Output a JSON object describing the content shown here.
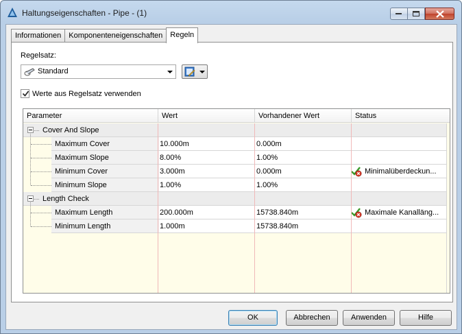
{
  "window": {
    "title": "Haltungseigenschaften - Pipe - (1)"
  },
  "tabs": [
    {
      "label": "Informationen"
    },
    {
      "label": "Komponenteneigenschaften"
    },
    {
      "label": "Regeln"
    }
  ],
  "ruleset": {
    "label": "Regelsatz:",
    "selected": "Standard",
    "use_ruleset_values_label": "Werte aus Regelsatz verwenden",
    "use_ruleset_values_checked": true
  },
  "grid": {
    "columns": [
      "Parameter",
      "Wert",
      "Vorhandener Wert",
      "Status"
    ],
    "groups": [
      {
        "name": "Cover And Slope",
        "rows": [
          {
            "parameter": "Maximum Cover",
            "value": "10.000m",
            "existing": "0.000m",
            "status": ""
          },
          {
            "parameter": "Maximum Slope",
            "value": "8.00%",
            "existing": "1.00%",
            "status": ""
          },
          {
            "parameter": "Minimum Cover",
            "value": "3.000m",
            "existing": "0.000m",
            "status": "Minimalüberdeckun..."
          },
          {
            "parameter": "Minimum Slope",
            "value": "1.00%",
            "existing": "1.00%",
            "status": ""
          }
        ]
      },
      {
        "name": "Length Check",
        "rows": [
          {
            "parameter": "Maximum Length",
            "value": "200.000m",
            "existing": "15738.840m",
            "status": "Maximale Kanalläng..."
          },
          {
            "parameter": "Minimum Length",
            "value": "1.000m",
            "existing": "15738.840m",
            "status": ""
          }
        ]
      }
    ]
  },
  "buttons": {
    "ok": "OK",
    "cancel": "Abbrechen",
    "apply": "Anwenden",
    "help": "Hilfe"
  },
  "colors": {
    "grid_background": "#fffde9",
    "status_check": "#3a9a2a",
    "status_error": "#d63a2a"
  }
}
